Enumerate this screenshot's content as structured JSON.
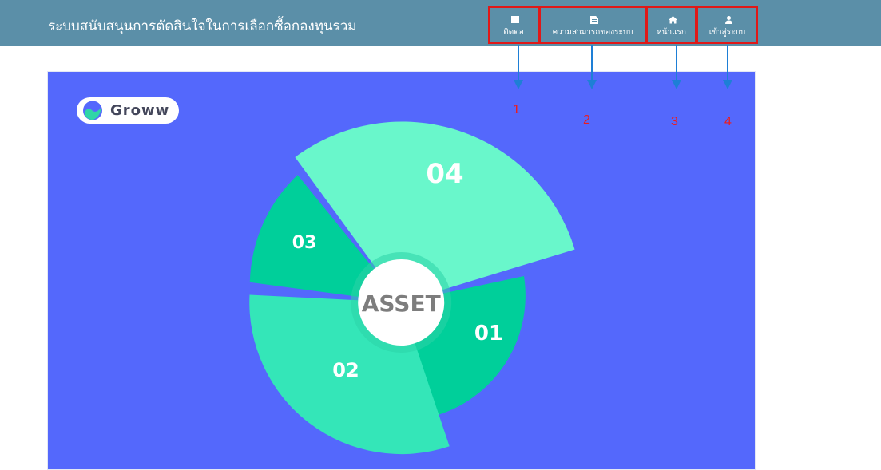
{
  "header": {
    "title": "ระบบสนับสนุนการตัดสินใจในการเลือกซื้อกองทุนรวม",
    "nav": [
      {
        "label": "ติดต่อ",
        "icon": "contact-card-icon"
      },
      {
        "label": "ความสามารถของระบบ",
        "icon": "document-icon"
      },
      {
        "label": "หน้าแรก",
        "icon": "home-icon"
      },
      {
        "label": "เข้าสู่ระบบ",
        "icon": "user-icon"
      }
    ]
  },
  "banner": {
    "logo_text": "Groww",
    "center_label": "ASSET",
    "segments": [
      "01",
      "02",
      "03",
      "04"
    ]
  },
  "annotations": [
    "1",
    "2",
    "3",
    "4"
  ],
  "colors": {
    "navbar": "#5b8fa8",
    "highlight_border": "#e01818",
    "arrow": "#1e7fd6",
    "hero_bg": "#5468fc",
    "segment_01": "#00cf9a",
    "segment_02": "#34e6b8",
    "segment_03": "#00cf9a",
    "segment_04": "#69f7cb"
  }
}
